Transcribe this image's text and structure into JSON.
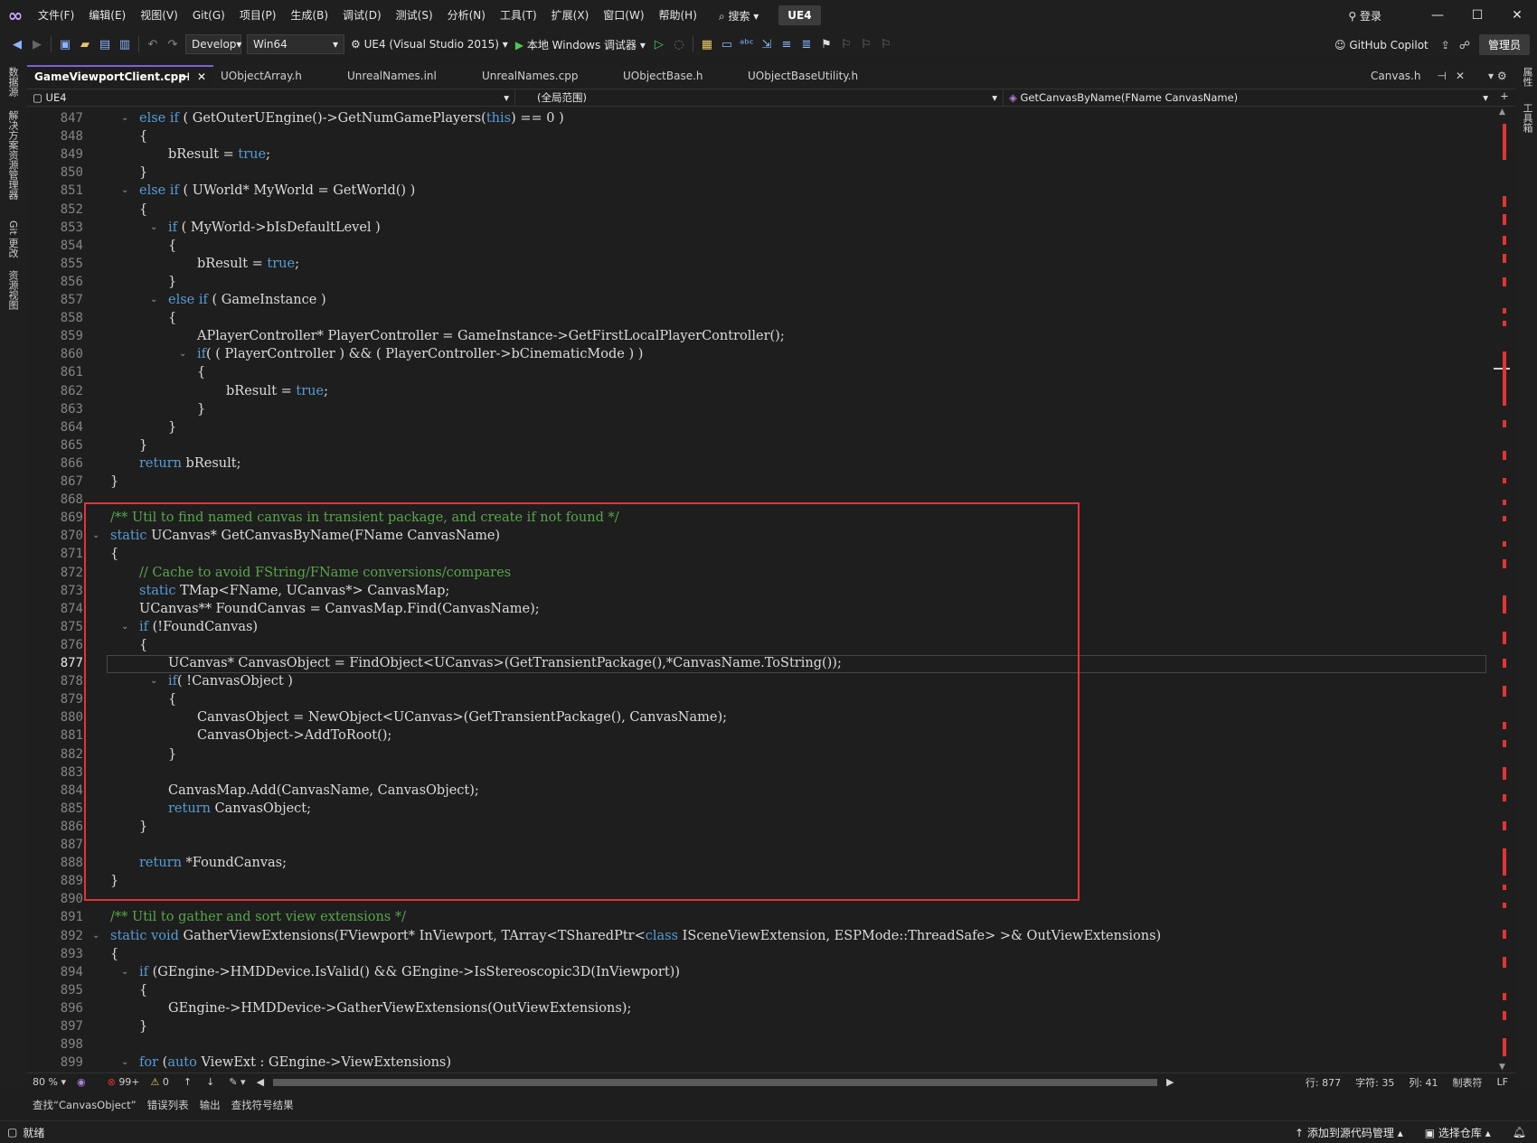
{
  "app": {
    "solution_badge": "UE4"
  },
  "menu": [
    "文件(F)",
    "编辑(E)",
    "视图(V)",
    "Git(G)",
    "项目(P)",
    "生成(B)",
    "调试(D)",
    "测试(S)",
    "分析(N)",
    "工具(T)",
    "扩展(X)",
    "窗口(W)",
    "帮助(H)"
  ],
  "search_label": "搜索",
  "login_label": "登录",
  "toolbar": {
    "config": "Develop",
    "platform": "Win64",
    "project": "UE4 (Visual Studio 2015)",
    "debugger": "本地 Windows 调试器",
    "copilot": "GitHub Copilot",
    "admin": "管理员"
  },
  "left_rail": [
    "数据源",
    "解决方案资源管理器",
    "Git 更改",
    "资源视图"
  ],
  "right_rail": [
    "属性",
    "工具箱"
  ],
  "tabs": [
    {
      "label": "GameViewportClient.cpp",
      "active": true
    },
    {
      "label": "UObjectArray.h"
    },
    {
      "label": "UnrealNames.inl"
    },
    {
      "label": "UnrealNames.cpp"
    },
    {
      "label": "UObjectBase.h"
    },
    {
      "label": "UObjectBaseUtility.h"
    }
  ],
  "right_tab": "Canvas.h",
  "nav": {
    "project": "UE4",
    "scope": "(全局范围)",
    "member": "GetCanvasByName(FName CanvasName)"
  },
  "current_line": 877,
  "lines": [
    {
      "n": 847,
      "i": 1,
      "t": "else if ( GetOuterUEngine()->GetNumGamePlayers(this) == 0 )",
      "f": true
    },
    {
      "n": 848,
      "i": 1,
      "t": "{"
    },
    {
      "n": 849,
      "i": 2,
      "t": "bResult = true;"
    },
    {
      "n": 850,
      "i": 1,
      "t": "}"
    },
    {
      "n": 851,
      "i": 1,
      "t": "else if ( UWorld* MyWorld = GetWorld() )",
      "f": true
    },
    {
      "n": 852,
      "i": 1,
      "t": "{"
    },
    {
      "n": 853,
      "i": 2,
      "t": "if ( MyWorld->bIsDefaultLevel )",
      "f": true
    },
    {
      "n": 854,
      "i": 2,
      "t": "{"
    },
    {
      "n": 855,
      "i": 3,
      "t": "bResult = true;"
    },
    {
      "n": 856,
      "i": 2,
      "t": "}"
    },
    {
      "n": 857,
      "i": 2,
      "t": "else if ( GameInstance )",
      "f": true
    },
    {
      "n": 858,
      "i": 2,
      "t": "{"
    },
    {
      "n": 859,
      "i": 3,
      "t": "APlayerController* PlayerController = GameInstance->GetFirstLocalPlayerController();"
    },
    {
      "n": 860,
      "i": 3,
      "t": "if( ( PlayerController ) && ( PlayerController->bCinematicMode ) )",
      "f": true
    },
    {
      "n": 861,
      "i": 3,
      "t": "{"
    },
    {
      "n": 862,
      "i": 4,
      "t": "bResult = true;"
    },
    {
      "n": 863,
      "i": 3,
      "t": "}"
    },
    {
      "n": 864,
      "i": 2,
      "t": "}"
    },
    {
      "n": 865,
      "i": 1,
      "t": "}"
    },
    {
      "n": 866,
      "i": 1,
      "t": "return bResult;"
    },
    {
      "n": 867,
      "i": 0,
      "t": "}"
    },
    {
      "n": 868,
      "i": 0,
      "t": ""
    },
    {
      "n": 869,
      "i": 0,
      "t": "/** Util to find named canvas in transient package, and create if not found */",
      "c": true
    },
    {
      "n": 870,
      "i": 0,
      "t": "static UCanvas* GetCanvasByName(FName CanvasName)",
      "f": true
    },
    {
      "n": 871,
      "i": 0,
      "t": "{"
    },
    {
      "n": 872,
      "i": 1,
      "t": "// Cache to avoid FString/FName conversions/compares",
      "c": true
    },
    {
      "n": 873,
      "i": 1,
      "t": "static TMap<FName, UCanvas*> CanvasMap;"
    },
    {
      "n": 874,
      "i": 1,
      "t": "UCanvas** FoundCanvas = CanvasMap.Find(CanvasName);"
    },
    {
      "n": 875,
      "i": 1,
      "t": "if (!FoundCanvas)",
      "f": true
    },
    {
      "n": 876,
      "i": 1,
      "t": "{"
    },
    {
      "n": 877,
      "i": 2,
      "t": "UCanvas* CanvasObject = FindObject<UCanvas>(GetTransientPackage(),*CanvasName.ToString());"
    },
    {
      "n": 878,
      "i": 2,
      "t": "if( !CanvasObject )",
      "f": true
    },
    {
      "n": 879,
      "i": 2,
      "t": "{"
    },
    {
      "n": 880,
      "i": 3,
      "t": "CanvasObject = NewObject<UCanvas>(GetTransientPackage(), CanvasName);"
    },
    {
      "n": 881,
      "i": 3,
      "t": "CanvasObject->AddToRoot();"
    },
    {
      "n": 882,
      "i": 2,
      "t": "}"
    },
    {
      "n": 883,
      "i": 0,
      "t": ""
    },
    {
      "n": 884,
      "i": 2,
      "t": "CanvasMap.Add(CanvasName, CanvasObject);"
    },
    {
      "n": 885,
      "i": 2,
      "t": "return CanvasObject;"
    },
    {
      "n": 886,
      "i": 1,
      "t": "}"
    },
    {
      "n": 887,
      "i": 0,
      "t": ""
    },
    {
      "n": 888,
      "i": 1,
      "t": "return *FoundCanvas;"
    },
    {
      "n": 889,
      "i": 0,
      "t": "}"
    },
    {
      "n": 890,
      "i": 0,
      "t": ""
    },
    {
      "n": 891,
      "i": 0,
      "t": "/** Util to gather and sort view extensions */",
      "c": true
    },
    {
      "n": 892,
      "i": 0,
      "t": "static void GatherViewExtensions(FViewport* InViewport, TArray<TSharedPtr<class ISceneViewExtension, ESPMode::ThreadSafe> >& OutViewExtensions)",
      "f": true
    },
    {
      "n": 893,
      "i": 0,
      "t": "{"
    },
    {
      "n": 894,
      "i": 1,
      "t": "if (GEngine->HMDDevice.IsValid() && GEngine->IsStereoscopic3D(InViewport))",
      "f": true
    },
    {
      "n": 895,
      "i": 1,
      "t": "{"
    },
    {
      "n": 896,
      "i": 2,
      "t": "GEngine->HMDDevice->GatherViewExtensions(OutViewExtensions);"
    },
    {
      "n": 897,
      "i": 1,
      "t": "}"
    },
    {
      "n": 898,
      "i": 0,
      "t": ""
    },
    {
      "n": 899,
      "i": 1,
      "t": "for (auto ViewExt : GEngine->ViewExtensions)",
      "f": true
    }
  ],
  "status_row": {
    "zoom": "80 %",
    "errors": "99+",
    "warnings": "0",
    "line": "行: 877",
    "chars": "字符: 35",
    "col": "列: 41",
    "tabs": "制表符",
    "eol": "LF"
  },
  "bottom_tabs": [
    "查找“CanvasObject”",
    "错误列表",
    "输出",
    "查找符号结果"
  ],
  "statusbar": {
    "ready": "就绪",
    "source_control": "添加到源代码管理",
    "repo": "选择仓库"
  },
  "colors": {
    "accent": "#7b62d1",
    "highlight": "#e53333",
    "keyword": "#569cd6",
    "comment": "#57a64a"
  }
}
